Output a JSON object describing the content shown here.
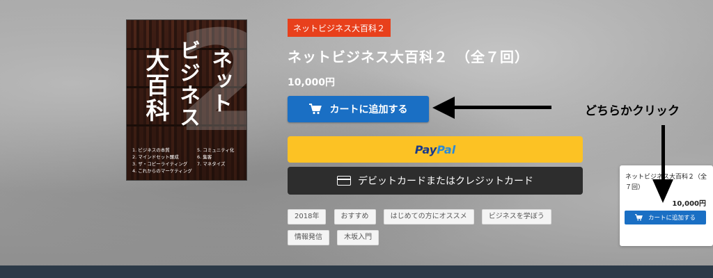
{
  "product": {
    "badge": "ネットビジネス大百科２",
    "title": "ネットビジネス大百科２　（全７回）",
    "price": "10,000円",
    "add_to_cart_label": "カートに追加する",
    "paypal_pay": "Pay",
    "paypal_pal": "Pal",
    "debit_label": "デビットカードまたはクレジットカード"
  },
  "cover": {
    "big_number": "2",
    "col_right": "ネット",
    "col_middle": "ビジネス",
    "col_left": "大百科",
    "toc_left": [
      "1. ビジネスの本質",
      "2. マインドセット醸成",
      "3. ザ・コピーライティング",
      "4. これからのマーケティング"
    ],
    "toc_right": [
      "5. コミュニティ化",
      "6. 集客",
      "7. マネタイズ"
    ]
  },
  "tags": [
    "2018年",
    "おすすめ",
    "はじめての方にオススメ",
    "ビジネスを学ぼう",
    "情報発信",
    "木坂入門"
  ],
  "annotation": {
    "callout": "どちらかクリック"
  },
  "widget": {
    "title": "ネットビジネス大百科２（全７回）",
    "price": "10,000円",
    "add_to_cart_label": "カートに追加する"
  },
  "colors": {
    "badge": "#e8401c",
    "cart_button": "#1a6fc4",
    "paypal_button": "#fcc224",
    "debit_button": "#2d2d2d"
  }
}
